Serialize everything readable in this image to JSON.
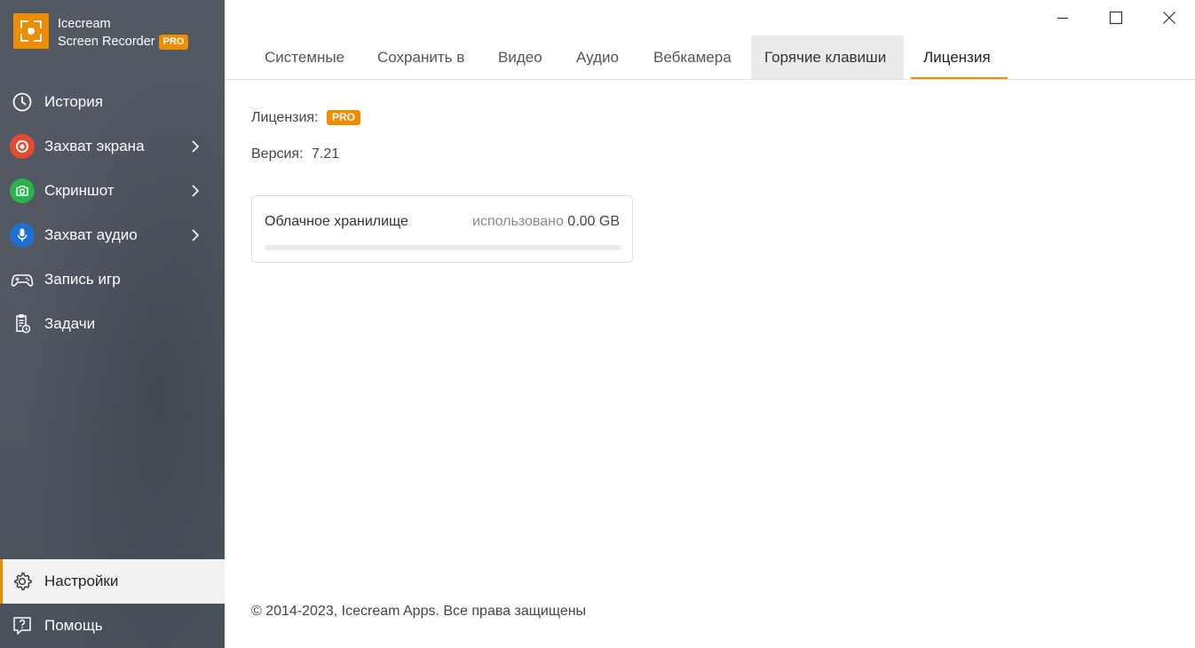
{
  "app": {
    "line1": "Icecream",
    "line2": "Screen Recorder",
    "badge": "PRO"
  },
  "sidebar": {
    "items": [
      {
        "label": "История",
        "icon": "clock-icon"
      },
      {
        "label": "Захват экрана",
        "icon": "record-icon"
      },
      {
        "label": "Скриншот",
        "icon": "camera-icon"
      },
      {
        "label": "Захват аудио",
        "icon": "microphone-icon"
      },
      {
        "label": "Запись игр",
        "icon": "gamepad-icon"
      },
      {
        "label": "Задачи",
        "icon": "tasks-icon"
      }
    ],
    "bottom": [
      {
        "label": "Настройки",
        "icon": "gear-icon"
      },
      {
        "label": "Помощь",
        "icon": "help-icon"
      }
    ]
  },
  "tabs": [
    "Системные",
    "Сохранить в",
    "Видео",
    "Аудио",
    "Вебкамера",
    "Горячие клавиши",
    "Лицензия"
  ],
  "license": {
    "label": "Лицензия:",
    "badge": "PRO",
    "version_label": "Версия:",
    "version": "7.21"
  },
  "storage": {
    "title": "Облачное хранилище",
    "used_label": "использовано",
    "used_value": "0.00 GB",
    "usage_fraction": 0
  },
  "footer": "© 2014-2023, Icecream Apps. Все права защищены",
  "colors": {
    "accent": "#f08c00",
    "record": "#e6492d",
    "screenshot": "#2bb24c",
    "audio": "#1f6fd1"
  }
}
